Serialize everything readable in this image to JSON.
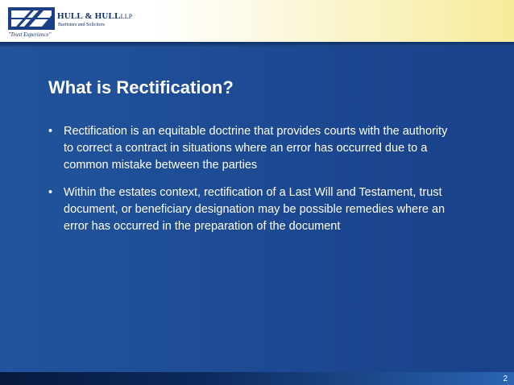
{
  "header": {
    "firm_name": "HULL & HULL",
    "firm_suffix": "LLP",
    "firm_subtitle": "Barristers and Solicitors",
    "tagline": "\"Trust Experience\"",
    "logo_icon": "hull-and-hull-logo-icon"
  },
  "slide": {
    "title": "What is Rectification?",
    "bullet_symbol": "•",
    "bullets": [
      "Rectification is an equitable doctrine that provides courts with the authority to correct a contract in situations where an error has occurred due to a common mistake between the parties",
      "Within the estates context, rectification of a Last Will and Testament, trust document, or beneficiary designation may be possible remedies where an error has occurred in the preparation of the document"
    ]
  },
  "footer": {
    "page_number": "2"
  },
  "colors": {
    "navy": "#0e2f6e",
    "slide_blue": "#1f4a8c",
    "text": "#ffffff"
  }
}
